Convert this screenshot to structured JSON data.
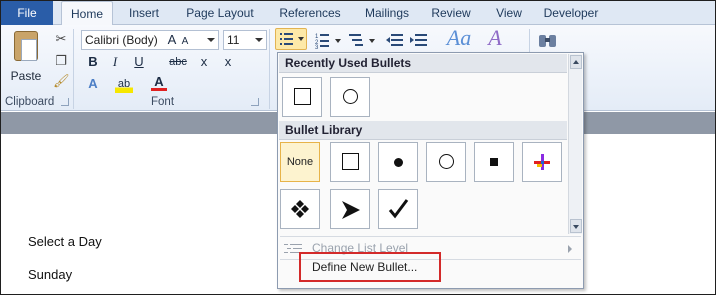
{
  "tabs": [
    "File",
    "Home",
    "Insert",
    "Page Layout",
    "References",
    "Mailings",
    "Review",
    "View",
    "Developer"
  ],
  "ribbon": {
    "paste_label": "Paste",
    "clipboard_label": "Clipboard",
    "font_group_label": "Font",
    "font_name": "Calibri (Body)",
    "font_size": "11",
    "grow_font": "A",
    "shrink_font": "A",
    "bold": "B",
    "italic": "I",
    "underline": "U",
    "strikethrough": "abc",
    "subscript": "x",
    "superscript": "x",
    "text_effects": "A",
    "font_color": "A",
    "aa": "Aa",
    "change_case_letter": "A"
  },
  "document": {
    "lines": [
      "Select a Day",
      "Sunday"
    ]
  },
  "dropdown": {
    "recent_header": "Recently Used Bullets",
    "library_header": "Bullet Library",
    "none_label": "None",
    "change_level": "Change List Level",
    "define_new": "Define New Bullet..."
  }
}
